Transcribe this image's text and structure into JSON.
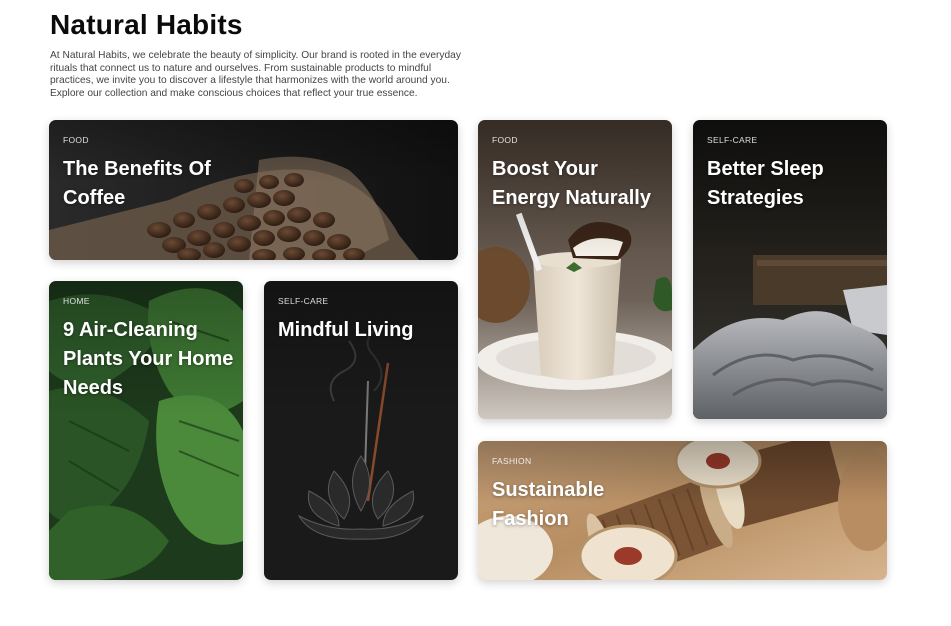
{
  "header": {
    "title": "Natural Habits",
    "intro": "At Natural Habits, we celebrate the beauty of simplicity. Our brand is rooted in the everyday rituals that connect us to nature and ourselves. From sustainable products to mindful practices, we invite you to discover a lifestyle that harmonizes with the world around you. Explore our collection and make conscious choices that reflect your true essence."
  },
  "cards": {
    "coffee": {
      "category": "FOOD",
      "title": "The Benefits Of Coffee",
      "image": "coffee-beans-image"
    },
    "energy": {
      "category": "FOOD",
      "title": "Boost Your Energy Naturally",
      "image": "smoothie-image"
    },
    "sleep": {
      "category": "SELF-CARE",
      "title": "Better Sleep Strategies",
      "image": "bed-image"
    },
    "plants": {
      "category": "HOME",
      "title": "9 Air-Cleaning Plants Your Home Needs",
      "image": "monstera-leaves-image"
    },
    "mindful": {
      "category": "SELF-CARE",
      "title": "Mindful Living",
      "image": "incense-image"
    },
    "fashion": {
      "category": "FASHION",
      "title": "Sustainable Fashion",
      "image": "thread-spools-image"
    }
  }
}
